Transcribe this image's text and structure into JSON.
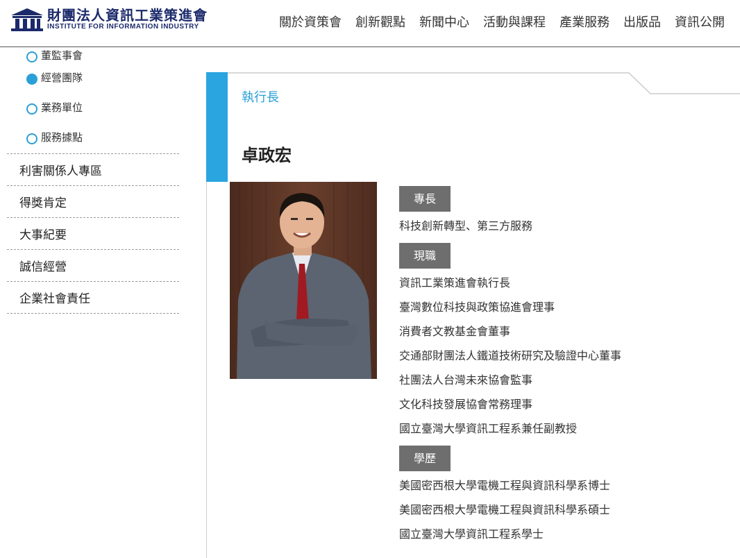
{
  "header": {
    "logo_zh": "財團法人資訊工業策進會",
    "logo_en": "INSTITUTE FOR INFORMATION INDUSTRY",
    "nav": [
      "關於資策會",
      "創新觀點",
      "新聞中心",
      "活動與課程",
      "產業服務",
      "出版品",
      "資訊公開"
    ]
  },
  "sidebar": {
    "sub_items": [
      {
        "label": "董監事會",
        "selected": false
      },
      {
        "label": "經營團隊",
        "selected": true
      },
      {
        "label": "業務單位",
        "selected": false
      },
      {
        "label": "服務據點",
        "selected": false
      }
    ],
    "main_items": [
      "利害關係人專區",
      "得獎肯定",
      "大事紀要",
      "誠信經營",
      "企業社會責任"
    ]
  },
  "content": {
    "tab_label": "執行長",
    "name": "卓政宏",
    "sections": [
      {
        "label": "專長",
        "lines": [
          "科技創新轉型、第三方服務"
        ]
      },
      {
        "label": "現職",
        "lines": [
          "資訊工業策進會執行長",
          "臺灣數位科技與政策協進會理事",
          "消費者文教基金會董事",
          "交通部財團法人鐵道技術研究及驗證中心董事",
          "社團法人台灣未來協會監事",
          "文化科技發展協會常務理事",
          "國立臺灣大學資訊工程系兼任副教授"
        ]
      },
      {
        "label": "學歷",
        "lines": [
          "美國密西根大學電機工程與資訊科學系博士",
          "美國密西根大學電機工程與資訊科學系碩士",
          "國立臺灣大學資訊工程系學士"
        ]
      }
    ]
  },
  "colors": {
    "accent": "#2aa5e0",
    "badge": "#6e6e6e",
    "brand": "#1b2a6b"
  }
}
